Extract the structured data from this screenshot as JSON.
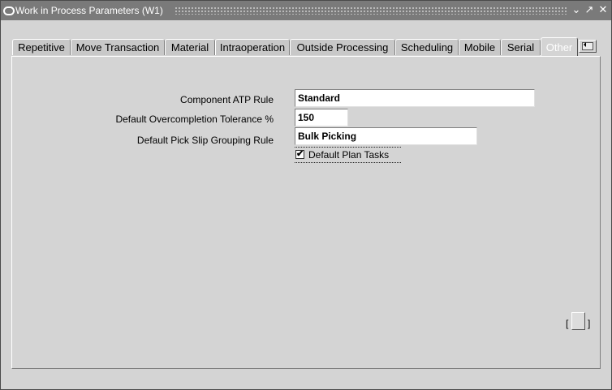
{
  "window": {
    "title": "Work in Process Parameters (W1)",
    "minimize_glyph": "⌄",
    "restore_glyph": "↗",
    "close_glyph": "✕"
  },
  "tabs": [
    {
      "label": "Repetitive",
      "active": false
    },
    {
      "label": "Move Transaction",
      "active": false
    },
    {
      "label": "Material",
      "active": false
    },
    {
      "label": "Intraoperation",
      "active": false
    },
    {
      "label": "Outside Processing",
      "active": false
    },
    {
      "label": "Scheduling",
      "active": false
    },
    {
      "label": "Mobile",
      "active": false
    },
    {
      "label": "Serial",
      "active": false
    },
    {
      "label": "Other",
      "active": true
    }
  ],
  "form": {
    "component_atp_rule": {
      "label": "Component ATP Rule",
      "value": "Standard"
    },
    "overcompletion_tolerance": {
      "label": "Default Overcompletion Tolerance %",
      "value": "150"
    },
    "pick_slip_grouping": {
      "label": "Default Pick Slip Grouping Rule",
      "value": "Bulk Picking"
    },
    "default_plan_tasks": {
      "label": "Default Plan Tasks",
      "checked": true,
      "check_glyph": "✔"
    }
  },
  "footer": {
    "bracket_open": "[",
    "bracket_close": "]"
  }
}
